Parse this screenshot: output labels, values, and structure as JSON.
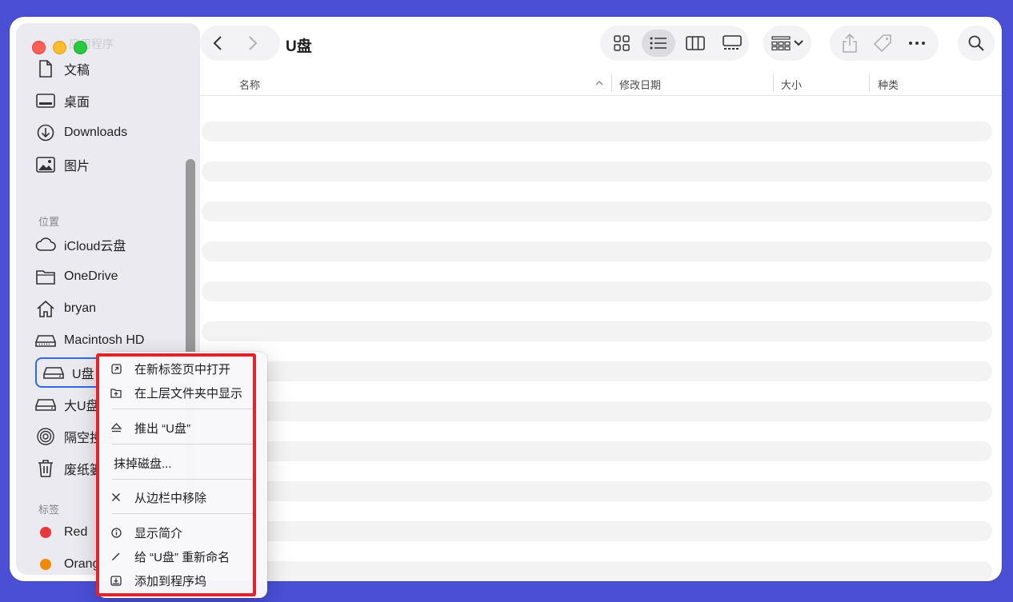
{
  "window": {
    "title": "U盘"
  },
  "sidebar": {
    "faded_top_label": "应用程序",
    "favorites": [
      {
        "label": "文稿",
        "icon": "document-icon"
      },
      {
        "label": "桌面",
        "icon": "desktop-icon"
      },
      {
        "label": "Downloads",
        "icon": "download-icon"
      },
      {
        "label": "图片",
        "icon": "photo-icon"
      }
    ],
    "locations_header": "位置",
    "locations": [
      {
        "label": "iCloud云盘",
        "icon": "cloud-icon"
      },
      {
        "label": "OneDrive",
        "icon": "folder-icon"
      },
      {
        "label": "bryan",
        "icon": "home-icon"
      },
      {
        "label": "Macintosh HD",
        "icon": "disk-icon"
      },
      {
        "label": "U盘",
        "icon": "external-disk-icon"
      },
      {
        "label": "大U盘",
        "icon": "external-disk-icon"
      },
      {
        "label": "隔空投送",
        "icon": "airdrop-icon"
      },
      {
        "label": "废纸篓",
        "icon": "trash-icon"
      }
    ],
    "tags_header": "标签",
    "tags": [
      {
        "label": "Red",
        "color": "#e8383d"
      },
      {
        "label": "Orange",
        "color": "#f08a00"
      }
    ]
  },
  "columns": {
    "name": "名称",
    "date": "修改日期",
    "size": "大小",
    "kind": "种类"
  },
  "context_menu": {
    "items": [
      {
        "label": "在新标签页中打开",
        "icon": "new-tab-icon"
      },
      {
        "label": "在上层文件夹中显示",
        "icon": "enclosing-folder-icon"
      },
      {
        "label": "推出 “U盘”",
        "icon": "eject-icon"
      },
      {
        "label": "抹掉磁盘...",
        "icon": ""
      },
      {
        "label": "从边栏中移除",
        "icon": "remove-icon"
      },
      {
        "label": "显示简介",
        "icon": "info-icon"
      },
      {
        "label": "给 “U盘” 重新命名",
        "icon": "rename-icon"
      },
      {
        "label": "添加到程序坞",
        "icon": "dock-icon"
      }
    ]
  },
  "colors": {
    "background": "#4a4fd6",
    "highlight": "#e0232c",
    "selection": "#2f6ae2"
  }
}
